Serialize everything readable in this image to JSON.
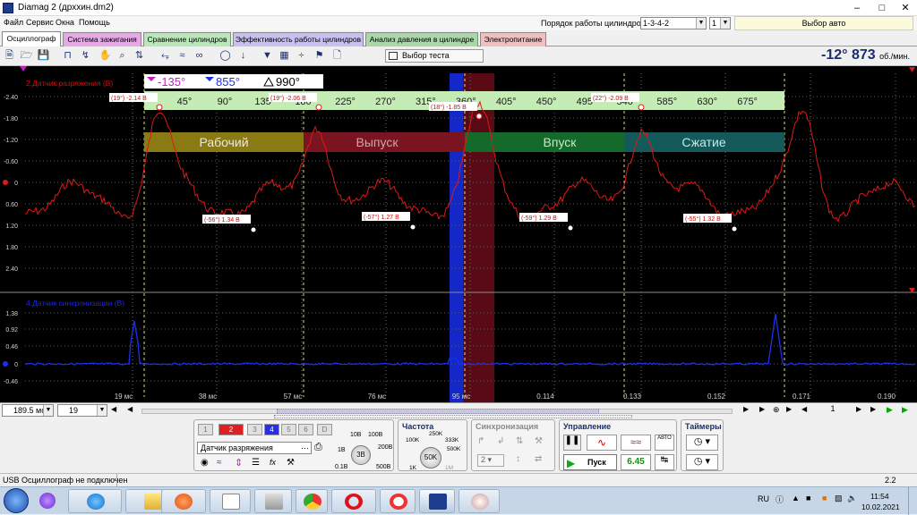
{
  "window": {
    "title": "Diamag 2 (дрххин.dm2)"
  },
  "menu": {
    "items": [
      "Файл",
      "Сервис",
      "Окна",
      "Помощь"
    ],
    "cylinder_order_label": "Порядок работы цилиндров",
    "cylinder_order_value": "1-3-4-2",
    "cylinder_number": "1",
    "auto_select": "Выбор авто"
  },
  "tabs": [
    {
      "label": "Осциллограф",
      "color": "#ffffff"
    },
    {
      "label": "Система зажигания",
      "color": "#e8a8e8"
    },
    {
      "label": "Сравнение цилиндров",
      "color": "#b8e8b8"
    },
    {
      "label": "Эффективность работы цилиндров",
      "color": "#c8c0f0"
    },
    {
      "label": "Анализ давления в цилиндре",
      "color": "#a8d8a8"
    },
    {
      "label": "Электропитание",
      "color": "#f0c0c0"
    }
  ],
  "toolbar": {
    "test_select": "Выбор теста",
    "rpm_value": "-12° 873",
    "rpm_unit": "об./мин."
  },
  "scope": {
    "ch1_label": "2.Датчик разряжения (В)",
    "ch2_label": "4.Датчик синхронизации (В)",
    "cursor_a": "-135°",
    "cursor_b": "855°",
    "delta": "990°",
    "angle_ticks": [
      "45°",
      "90°",
      "135°",
      "180°",
      "225°",
      "270°",
      "315°",
      "360°",
      "405°",
      "450°",
      "495°",
      "540°",
      "585°",
      "630°",
      "675°"
    ],
    "phases": [
      {
        "label": "Рабочий",
        "color": "#8a7a14"
      },
      {
        "label": "Выпуск",
        "color": "#7a1420"
      },
      {
        "label": "Впуск",
        "color": "#146a2a"
      },
      {
        "label": "Сжатие",
        "color": "#145a5a"
      }
    ],
    "y1_ticks": [
      "-2.40",
      "-1.80",
      "-1.20",
      "-0.60",
      "0",
      "0.60",
      "1.20",
      "1.80",
      "2.40"
    ],
    "y2_ticks": [
      "1.38",
      "0.92",
      "0.46",
      "0",
      "-0.46"
    ],
    "x_ticks": [
      "19 мс",
      "38 мс",
      "57 мс",
      "76 мс",
      "95 мс",
      "0.114",
      "0.133",
      "0.152",
      "0.171",
      "0.190"
    ],
    "peak_labels": [
      "(19°) -2.14 В",
      "(19°) -2.06 В",
      "(18°) -1.85 В",
      "(22°) -2.09 В"
    ],
    "min_labels": [
      "(-56°) 1.34 В",
      "(-57°) 1.27 В",
      "(-59°) 1.29 В",
      "(-55°) 1.32 В"
    ]
  },
  "bottom": {
    "timebase": "189.5 мс",
    "channels_count": "19",
    "page": "1"
  },
  "panel": {
    "channel_buttons": [
      "1",
      "2",
      "3",
      "4",
      "5",
      "6",
      "D"
    ],
    "sensor": "Датчик разряжения",
    "volts_labels": [
      "10В",
      "100В",
      "200В",
      "500В",
      "0.1В",
      "1В"
    ],
    "volts_value": "3В",
    "freq_title": "Частота",
    "freq_labels": [
      "250K",
      "100K",
      "333K",
      "500K",
      "1K",
      "1M"
    ],
    "freq_value": "50K",
    "sync_title": "Синхронизация",
    "sync_value": "2",
    "control_title": "Управление",
    "start": "Пуск",
    "version": "6.45",
    "auto": "АВТО",
    "timers_title": "Таймеры"
  },
  "status": {
    "left": "USB Осциллограф не подключен",
    "right": "2.2"
  },
  "taskbar": {
    "lang": "RU",
    "time": "11:54",
    "date": "10.02.2021"
  }
}
